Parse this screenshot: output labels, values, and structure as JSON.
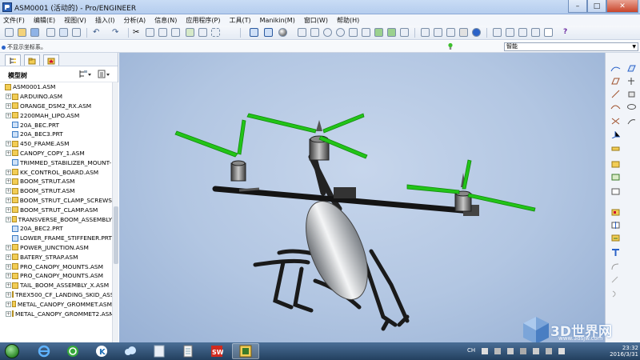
{
  "window": {
    "title": "ASM0001 (活动的) - Pro/ENGINEER",
    "min_label": "–",
    "max_label": "□",
    "close_label": "✕"
  },
  "menu": [
    "文件(F)",
    "编辑(E)",
    "视图(V)",
    "插入(I)",
    "分析(A)",
    "信息(N)",
    "应用程序(P)",
    "工具(T)",
    "Manikin(M)",
    "窗口(W)",
    "帮助(H)"
  ],
  "status": {
    "message": "不显示坐标系。",
    "filter_value": "智能"
  },
  "model_tree": {
    "label": "模型树",
    "root": "ASM0001.ASM",
    "items": [
      {
        "name": "ARDUINO.ASM",
        "type": "asm",
        "expandable": true
      },
      {
        "name": "ORANGE_DSM2_RX.ASM",
        "type": "asm",
        "expandable": true
      },
      {
        "name": "2200MAH_LIPO.ASM",
        "type": "asm",
        "expandable": true
      },
      {
        "name": "20A_BEC.PRT",
        "type": "prt",
        "expandable": false
      },
      {
        "name": "20A_BEC3.PRT",
        "type": "prt",
        "expandable": false
      },
      {
        "name": "450_FRAME.ASM",
        "type": "asm",
        "expandable": true
      },
      {
        "name": "CANOPY_COPY_1.ASM",
        "type": "asm",
        "expandable": true
      },
      {
        "name": "TRIMMED_STABILIZER_MOUNT-",
        "type": "prt",
        "expandable": false
      },
      {
        "name": "KK_CONTROL_BOARD.ASM",
        "type": "asm",
        "expandable": true
      },
      {
        "name": "BOOM_STRUT.ASM",
        "type": "asm",
        "expandable": true
      },
      {
        "name": "BOOM_STRUT.ASM",
        "type": "asm",
        "expandable": true
      },
      {
        "name": "BOOM_STRUT_CLAMP_SCREWS",
        "type": "asm",
        "expandable": true
      },
      {
        "name": "BOOM_STRUT_CLAMP.ASM",
        "type": "asm",
        "expandable": true
      },
      {
        "name": "TRANSVERSE_BOOM_ASSEMBLY",
        "type": "asm",
        "expandable": true
      },
      {
        "name": "20A_BEC2.PRT",
        "type": "prt",
        "expandable": false
      },
      {
        "name": "LOWER_FRAME_STIFFENER.PRT",
        "type": "prt",
        "expandable": false
      },
      {
        "name": "POWER_JUNCTION.ASM",
        "type": "asm",
        "expandable": true
      },
      {
        "name": "BATERY_STRAP.ASM",
        "type": "asm",
        "expandable": true
      },
      {
        "name": "PRO_CANOPY_MOUNTS.ASM",
        "type": "asm",
        "expandable": true
      },
      {
        "name": "PRO_CANOPY_MOUNTS.ASM",
        "type": "asm",
        "expandable": true
      },
      {
        "name": "TAIL_BOOM_ASSEMBLY_X.ASM",
        "type": "asm",
        "expandable": true
      },
      {
        "name": "TREX500_CF_LANDING_SKID_ASS",
        "type": "asm",
        "expandable": true
      },
      {
        "name": "METAL_CANOPY_GROMMET.ASM",
        "type": "asm",
        "expandable": true
      },
      {
        "name": "METAL_CANOPY_GROMMET2.ASM",
        "type": "asm",
        "expandable": true
      }
    ]
  },
  "taskbar": {
    "tray_text": "CH",
    "time": "23:32",
    "date": "2016/3/31",
    "apps": [
      {
        "icon": "internet-explorer-icon",
        "active": false
      },
      {
        "icon": "app-green-ring-icon",
        "active": false
      },
      {
        "icon": "app-k-icon",
        "active": false
      },
      {
        "icon": "cloud-sync-icon",
        "active": false
      },
      {
        "icon": "document-window-icon",
        "active": false
      },
      {
        "icon": "solidworks-icon",
        "active": false
      },
      {
        "icon": "proengineer-icon",
        "active": true
      }
    ]
  },
  "watermark": {
    "brand": "3D世界网",
    "url": "www.3dsjw.com"
  },
  "colors": {
    "propeller": "#22c418",
    "viewport_bg": "#b2c6e2",
    "title_bg": "#c9dcf5"
  }
}
